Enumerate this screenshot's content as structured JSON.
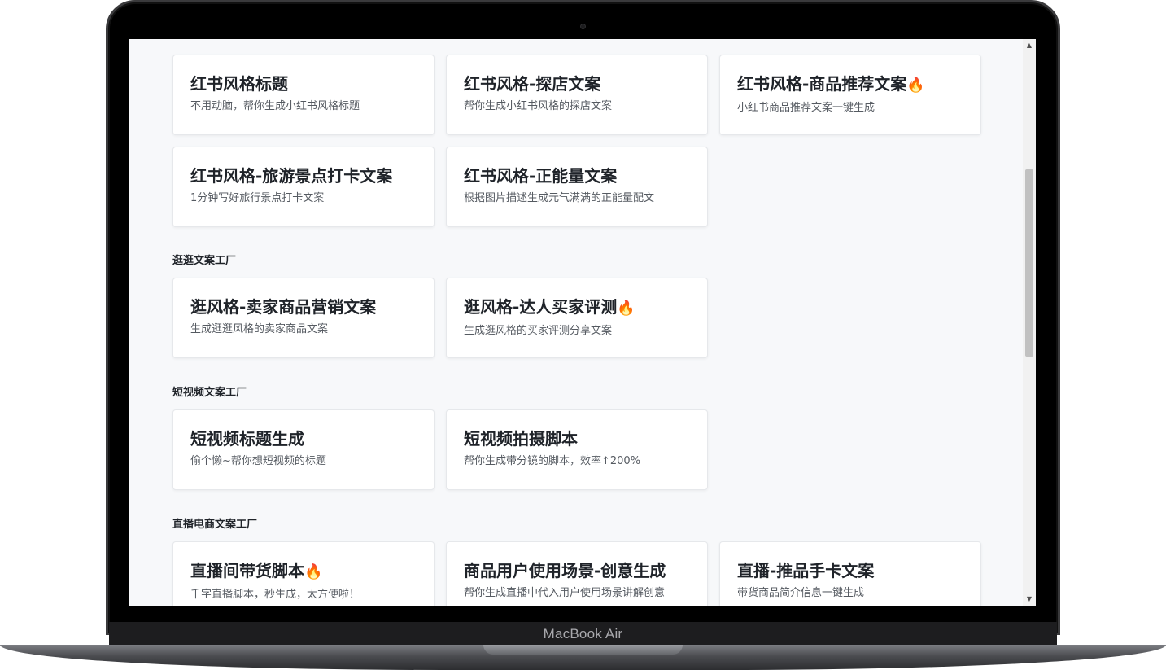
{
  "device": {
    "label": "MacBook Air"
  },
  "page": {
    "cards_top": [
      {
        "title": "红书风格标题",
        "desc": "不用动脑，帮你生成小红书风格标题",
        "hot": false
      },
      {
        "title": "红书风格-探店文案",
        "desc": "帮你生成小红书风格的探店文案",
        "hot": false
      },
      {
        "title": "红书风格-商品推荐文案",
        "desc": "小红书商品推荐文案一键生成",
        "hot": true
      },
      {
        "title": "红书风格-旅游景点打卡文案",
        "desc": "1分钟写好旅行景点打卡文案",
        "hot": false
      },
      {
        "title": "红书风格-正能量文案",
        "desc": "根据图片描述生成元气满满的正能量配文",
        "hot": false
      }
    ],
    "sections": [
      {
        "title": "逛逛文案工厂",
        "cards": [
          {
            "title": "逛风格-卖家商品营销文案",
            "desc": "生成逛逛风格的卖家商品文案",
            "hot": false
          },
          {
            "title": "逛风格-达人买家评测",
            "desc": "生成逛风格的买家评测分享文案",
            "hot": true
          }
        ]
      },
      {
        "title": "短视频文案工厂",
        "cards": [
          {
            "title": "短视频标题生成",
            "desc": "偷个懒~帮你想短视频的标题",
            "hot": false
          },
          {
            "title": "短视频拍摄脚本",
            "desc": "帮你生成带分镜的脚本，效率↑200%",
            "hot": false
          }
        ]
      },
      {
        "title": "直播电商文案工厂",
        "cards": [
          {
            "title": "直播间带货脚本",
            "desc": "千字直播脚本，秒生成，太方便啦！",
            "hot": true
          },
          {
            "title": "商品用户使用场景-创意生成",
            "desc": "帮你生成直播中代入用户使用场景讲解创意",
            "hot": false
          },
          {
            "title": "直播-推品手卡文案",
            "desc": "带货商品简介信息一键生成",
            "hot": false
          }
        ]
      }
    ],
    "hot_icon": "🔥",
    "scrollbar": {
      "up": "▲",
      "down": "▼"
    }
  }
}
